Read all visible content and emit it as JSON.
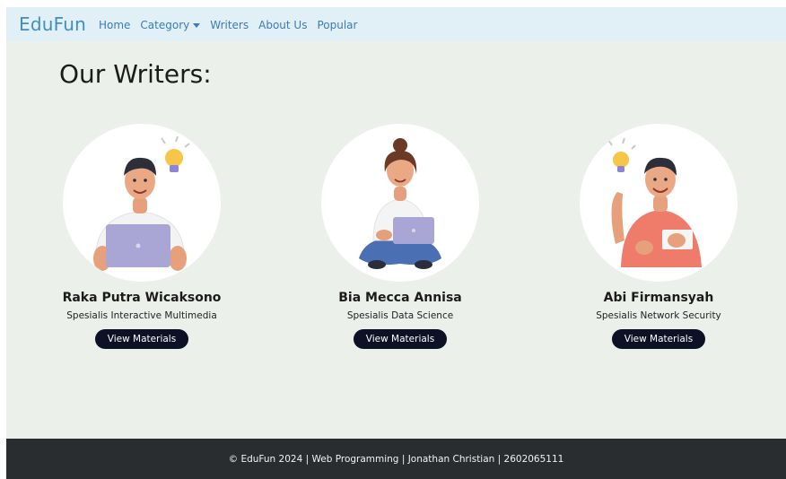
{
  "nav": {
    "brand": "EduFun",
    "links": [
      "Home",
      "Category",
      "Writers",
      "About Us",
      "Popular"
    ]
  },
  "main": {
    "title": "Our Writers:",
    "writers": [
      {
        "name": "Raka Putra Wicaksono",
        "specialty": "Spesialis Interactive Multimedia",
        "button": "View Materials"
      },
      {
        "name": "Bia Mecca Annisa",
        "specialty": "Spesialis Data Science",
        "button": "View Materials"
      },
      {
        "name": "Abi Firmansyah",
        "specialty": "Spesialis Network Security",
        "button": "View Materials"
      }
    ]
  },
  "footer": {
    "text": "© EduFun 2024 | Web Programming | Jonathan Christian | 2602065111"
  },
  "colors": {
    "navbar_bg": "#e1f0f7",
    "page_bg": "#ecf0ea",
    "button_bg": "#0d1126",
    "footer_bg": "#2a2d30",
    "link": "#3a7bb5"
  }
}
